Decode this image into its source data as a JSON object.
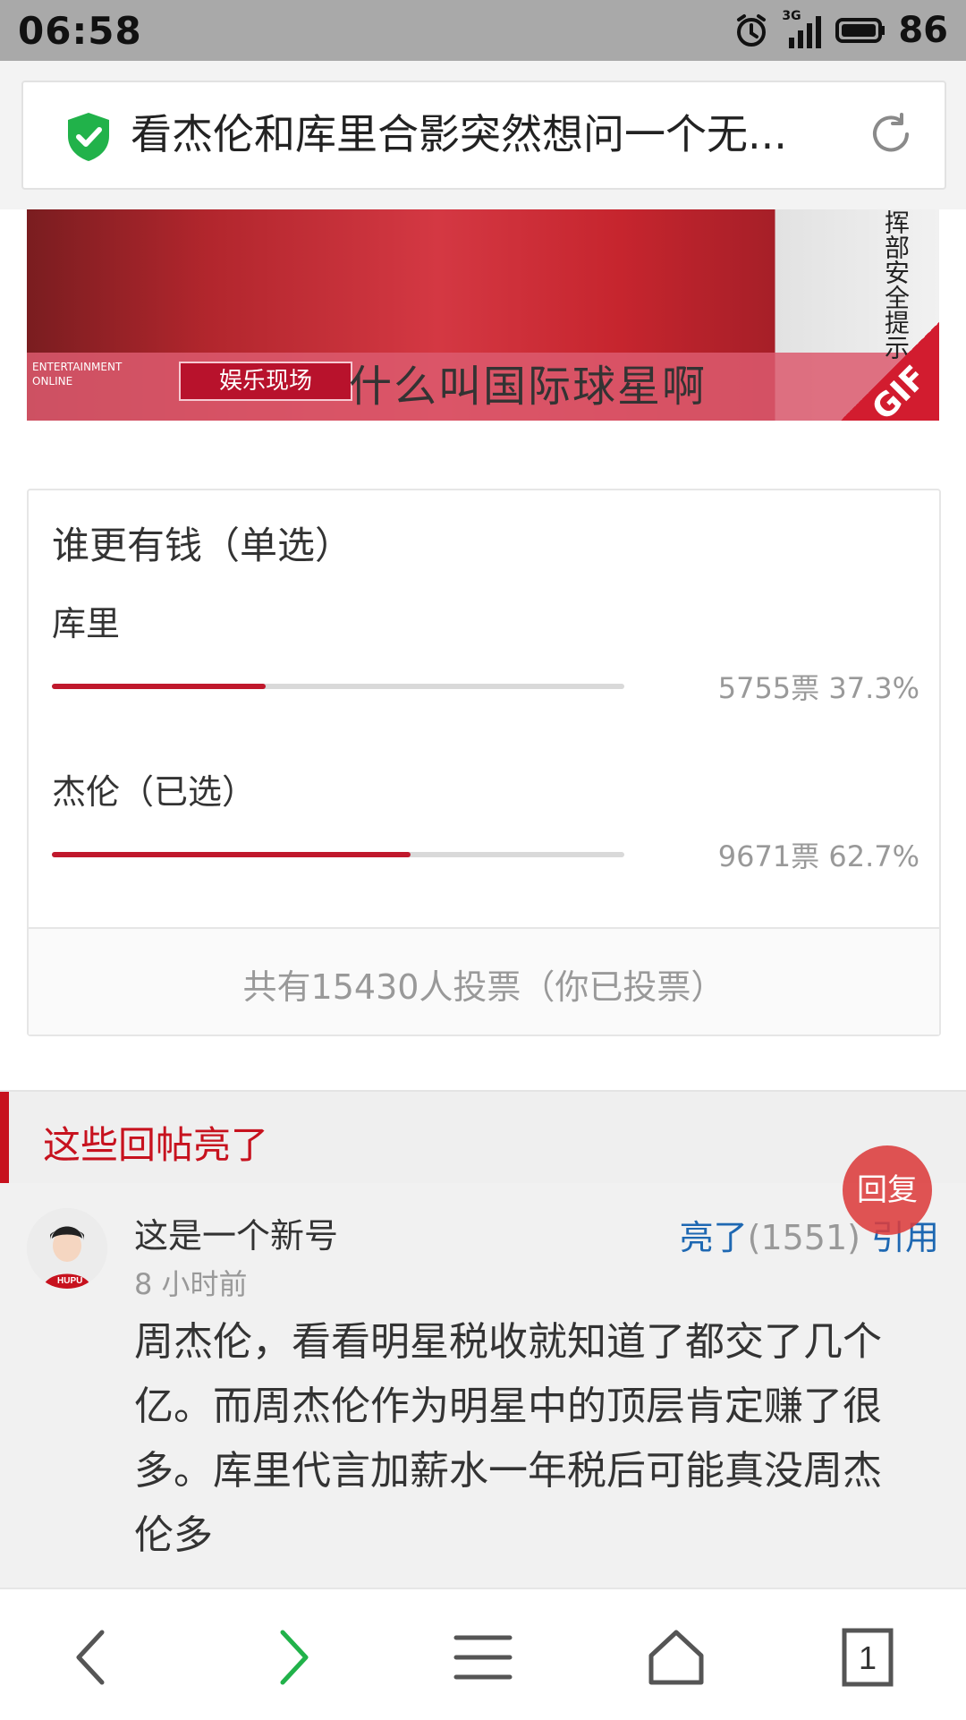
{
  "status_bar": {
    "time": "06:58",
    "network": "3G",
    "battery": "86"
  },
  "url_bar": {
    "title": "看杰伦和库里合影突然想问一个无...",
    "shield_icon": "shield-check-icon",
    "refresh_icon": "refresh-icon"
  },
  "media": {
    "caption": "什么叫国际球星啊",
    "left_label_line1": "ENTERTAINMENT",
    "left_label_line2": "ONLINE",
    "show_badge": "娱乐现场",
    "side_text": "挥部安全提示：",
    "gif_label": "GIF"
  },
  "poll": {
    "title": "谁更有钱（单选）",
    "options": [
      {
        "label": "库里",
        "votes": "5755票",
        "percent": "37.3%",
        "fraction": 0.373
      },
      {
        "label": "杰伦（已选）",
        "votes": "9671票",
        "percent": "62.7%",
        "fraction": 0.627
      }
    ],
    "footer": "共有15430人投票（你已投票）",
    "accent_color": "#c0182c"
  },
  "section": {
    "title": "这些回帖亮了",
    "accent_color": "#c7121e"
  },
  "comment": {
    "username": "这是一个新号",
    "time": "8 小时前",
    "light_label": "亮了",
    "light_count": "(1551)",
    "quote_label": "引用",
    "body": "周杰伦，看看明星税收就知道了都交了几个亿。而周杰伦作为明星中的顶层肯定赚了很多。库里代言加薪水一年税后可能真没周杰伦多",
    "avatar_icon": "avatar-icon"
  },
  "reply_button": "回复",
  "bottom_nav": {
    "back_icon": "back-arrow-icon",
    "forward_icon": "forward-arrow-icon",
    "menu_icon": "menu-icon",
    "home_icon": "home-icon",
    "tabs_count": "1"
  }
}
